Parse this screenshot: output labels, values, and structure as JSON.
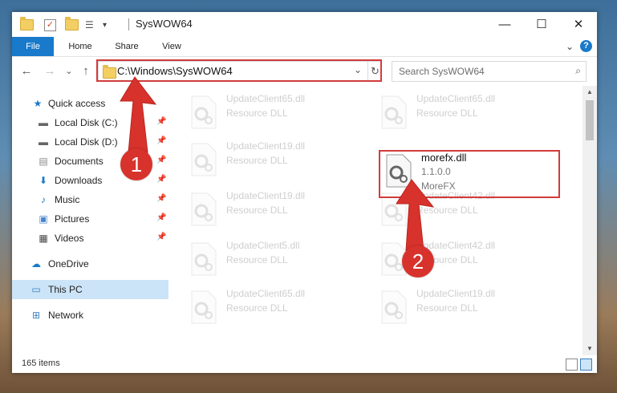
{
  "window": {
    "title": "SysWOW64",
    "controls": {
      "minimize": "—",
      "maximize": "☐",
      "close": "✕"
    }
  },
  "ribbon": {
    "tabs": [
      "File",
      "Home",
      "Share",
      "View"
    ],
    "expand_icon": "chevron-down-icon",
    "help_label": "?"
  },
  "address_bar": {
    "path": "C:\\Windows\\SysWOW64",
    "dropdown": "⌄",
    "refresh": "↻"
  },
  "search": {
    "placeholder": "Search SysWOW64",
    "icon": "⌕"
  },
  "nav": {
    "back": "←",
    "forward": "→",
    "recent": "⌄",
    "up": "↑"
  },
  "sidebar": {
    "items": [
      {
        "label": "Quick access",
        "icon": "star-icon",
        "pinned": false
      },
      {
        "label": "Local Disk (C:)",
        "icon": "drive-icon",
        "pinned": true
      },
      {
        "label": "Local Disk (D:)",
        "icon": "drive-icon",
        "pinned": true
      },
      {
        "label": "Documents",
        "icon": "documents-icon",
        "pinned": true
      },
      {
        "label": "Downloads",
        "icon": "downloads-icon",
        "pinned": true
      },
      {
        "label": "Music",
        "icon": "music-icon",
        "pinned": true
      },
      {
        "label": "Pictures",
        "icon": "pictures-icon",
        "pinned": true
      },
      {
        "label": "Videos",
        "icon": "videos-icon",
        "pinned": true
      },
      {
        "label": "OneDrive",
        "icon": "cloud-icon",
        "pinned": false
      },
      {
        "label": "This PC",
        "icon": "computer-icon",
        "pinned": false,
        "selected": true
      },
      {
        "label": "Network",
        "icon": "network-icon",
        "pinned": false
      }
    ]
  },
  "files": [
    {
      "name": "UpdateClient65.dll",
      "line2": "Resource DLL",
      "line3": "",
      "faded": true
    },
    {
      "name": "UpdateClient65.dll",
      "line2": "Resource DLL",
      "line3": "",
      "faded": true
    },
    {
      "name": "UpdateClient19.dll",
      "line2": "Resource DLL",
      "line3": "",
      "faded": true
    },
    {
      "name": "morefx.dll",
      "line2": "1.1.0.0",
      "line3": "MoreFX",
      "faded": false
    },
    {
      "name": "UpdateClient19.dll",
      "line2": "Resource DLL",
      "line3": "",
      "faded": true
    },
    {
      "name": "UpdateClient42.dll",
      "line2": "Resource DLL",
      "line3": "",
      "faded": true
    },
    {
      "name": "UpdateClient5.dll",
      "line2": "Resource DLL",
      "line3": "",
      "faded": true
    },
    {
      "name": "UpdateClient42.dll",
      "line2": "Resource DLL",
      "line3": "",
      "faded": true
    },
    {
      "name": "UpdateClient65.dll",
      "line2": "Resource DLL",
      "line3": "",
      "faded": true
    },
    {
      "name": "UpdateClient19.dll",
      "line2": "Resource DLL",
      "line3": "",
      "faded": true
    }
  ],
  "status": {
    "item_count": "165 items"
  },
  "annotations": {
    "badge1": "1",
    "badge2": "2",
    "color": "#d8322c"
  },
  "colors": {
    "accent": "#1979ca",
    "selection": "#cce4f7",
    "highlight": "#d23b3b"
  }
}
